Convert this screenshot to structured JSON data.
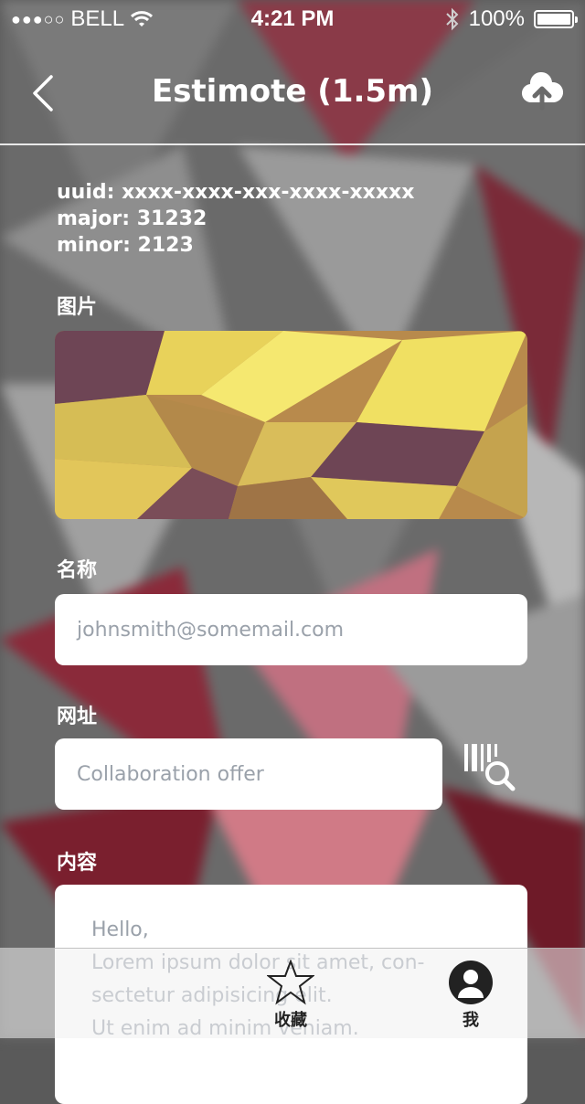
{
  "status_bar": {
    "carrier": "BELL",
    "signal_dots": "●●●○○",
    "time": "4:21 PM",
    "battery": "100%",
    "battery_level": 1.0
  },
  "nav": {
    "title": "Estimote (1.5m)",
    "back_icon": "chevron-left-icon",
    "upload_icon": "cloud-upload-icon"
  },
  "beacon": {
    "uuid": "uuid: xxxx-xxxx-xxx-xxxx-xxxxx",
    "major": "major: 31232",
    "minor": "minor: 2123"
  },
  "sections": {
    "image_label": "图片",
    "name_label": "名称",
    "url_label": "网址",
    "content_label": "内容"
  },
  "inputs": {
    "name_placeholder": "johnsmith@somemail.com",
    "url_placeholder": "Collaboration offer",
    "content_text": "Hello,\nLorem ipsum dolor sit amet, con-\nsectetur adipisicing elit.\nUt enim ad minim veniam."
  },
  "tabbar": {
    "favorites_label": "收藏",
    "me_label": "我"
  },
  "colors": {
    "accent_yellow": "#e8d25a",
    "accent_purple": "#6e4555",
    "background_red": "#8a2a3a"
  }
}
